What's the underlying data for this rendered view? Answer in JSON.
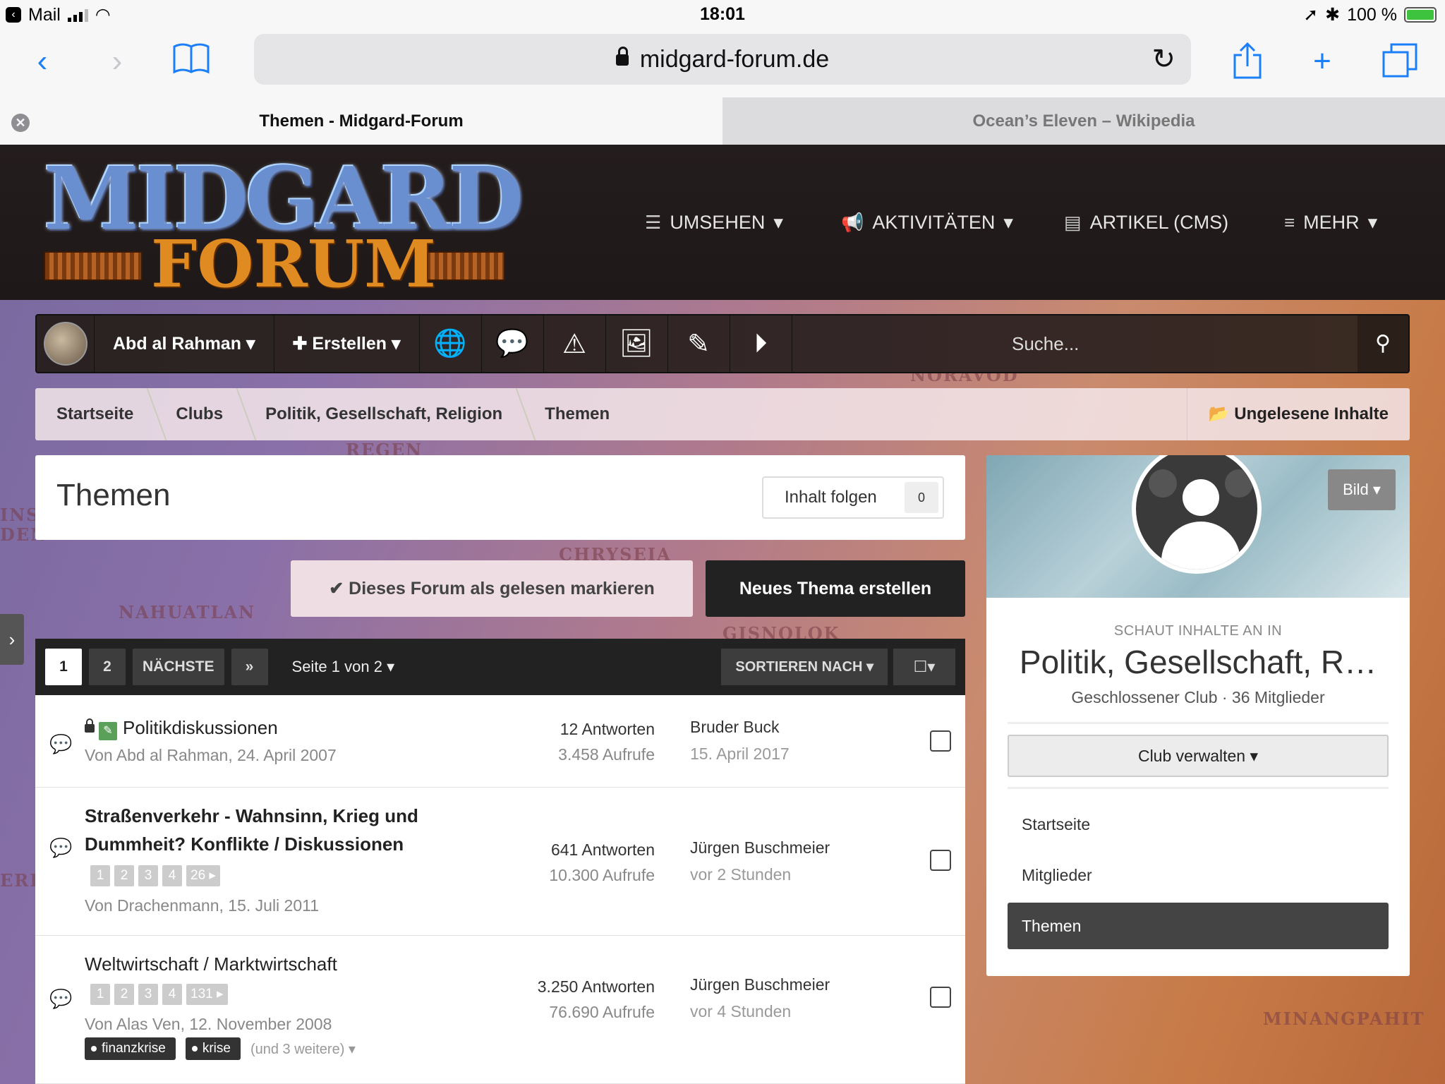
{
  "status": {
    "app": "Mail",
    "time": "18:01",
    "battery": "100 %"
  },
  "browser": {
    "url": "midgard-forum.de",
    "tabs": [
      {
        "label": "Themen - Midgard-Forum"
      },
      {
        "label": "Ocean’s Eleven – Wikipedia"
      }
    ]
  },
  "header": {
    "logo_line1": "MIDGARD",
    "logo_line2": "FORUM",
    "nav": [
      {
        "label": "UMSEHEN",
        "icon": "list-icon"
      },
      {
        "label": "AKTIVITÄTEN",
        "icon": "megaphone-icon"
      },
      {
        "label": "ARTIKEL (CMS)",
        "icon": "document-icon"
      },
      {
        "label": "MEHR",
        "icon": "menu-icon"
      }
    ]
  },
  "userbar": {
    "username": "Abd al Rahman",
    "create": "Erstellen",
    "search_placeholder": "Suche..."
  },
  "breadcrumb": [
    "Startseite",
    "Clubs",
    "Politik, Gesellschaft, Religion",
    "Themen"
  ],
  "unread_label": "Ungelesene Inhalte",
  "page": {
    "title": "Themen",
    "follow_label": "Inhalt folgen",
    "follow_count": "0",
    "mark_read": "Dieses Forum als gelesen markieren",
    "new_topic": "Neues Thema erstellen"
  },
  "pagination": {
    "pages": [
      "1",
      "2"
    ],
    "next": "NÄCHSTE",
    "last": "»",
    "page_of": "Seite 1 von 2",
    "sort": "SORTIEREN NACH"
  },
  "topics": [
    {
      "title": "Politikdiskussionen",
      "meta": "Von Abd al Rahman, 24. April 2007",
      "replies": "12 Antworten",
      "views": "3.458 Aufrufe",
      "last_user": "Bruder Buck",
      "last_date": "15. April 2017"
    },
    {
      "title_line1": "Straßenverkehr - Wahnsinn, Krieg und",
      "title_line2": "Dummheit? Konflikte / Diskussionen",
      "pages": [
        "1",
        "2",
        "3",
        "4",
        "26 ▸"
      ],
      "meta": "Von Drachenmann, 15. Juli 2011",
      "replies": "641 Antworten",
      "views": "10.300 Aufrufe",
      "last_user": "Jürgen Buschmeier",
      "last_date": "vor 2 Stunden"
    },
    {
      "title": "Weltwirtschaft / Marktwirtschaft",
      "pages": [
        "1",
        "2",
        "3",
        "4",
        "131 ▸"
      ],
      "meta": "Von Alas Ven, 12. November 2008",
      "tags": [
        "finanzkrise",
        "krise"
      ],
      "more_tags": "(und 3 weitere) ▾",
      "replies": "3.250 Antworten",
      "views": "76.690 Aufrufe",
      "last_user": "Jürgen Buschmeier",
      "last_date": "vor 4 Stunden"
    }
  ],
  "sidebar": {
    "bild": "Bild ▾",
    "label": "SCHAUT INHALTE AN IN",
    "club_name": "Politik, Gesellschaft, R…",
    "club_info": "Geschlossener Club  ·  36 Mitglieder",
    "manage": "Club verwalten ▾",
    "links": [
      "Startseite",
      "Mitglieder",
      "Themen"
    ]
  },
  "map_labels": [
    "NORAVOD",
    "REGEN",
    "CHRYSEIA",
    "NAHUATLAN",
    "GISNOLOK",
    "MINANGPAHIT",
    "INS",
    "DEN",
    "ERI"
  ]
}
